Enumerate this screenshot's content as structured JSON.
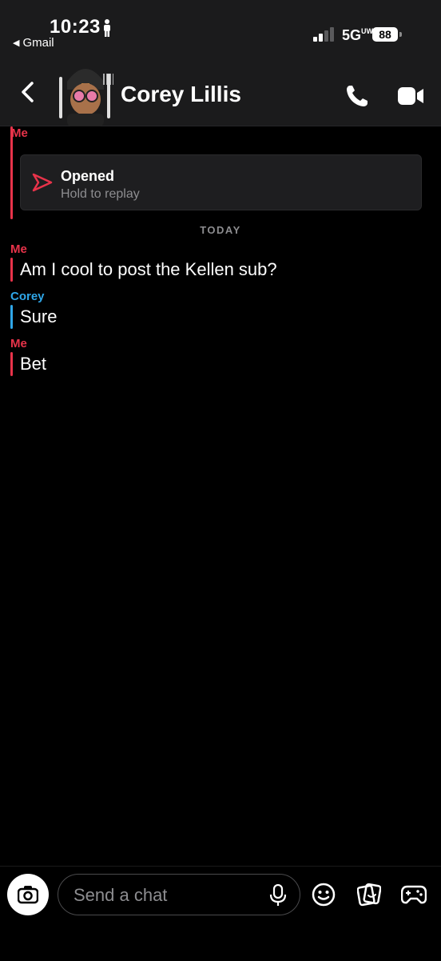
{
  "status_bar": {
    "time": "10:23",
    "back_app": "Gmail",
    "network": "5G",
    "network_sup": "UW",
    "battery": "88"
  },
  "header": {
    "contact_name": "Corey Lillis"
  },
  "chat": {
    "snap": {
      "sender": "Me",
      "status": "Opened",
      "hint": "Hold to replay"
    },
    "day_separator": "TODAY",
    "messages": [
      {
        "sender": "Me",
        "text": "Am I cool to post the Kellen sub?"
      },
      {
        "sender": "Corey",
        "text": "Sure"
      },
      {
        "sender": "Me",
        "text": "Bet"
      }
    ]
  },
  "composer": {
    "placeholder": "Send a chat"
  },
  "colors": {
    "me": "#e8334a",
    "them": "#2fa6e8",
    "background": "#000000",
    "header": "#1b1b1c"
  },
  "icons": [
    "person-icon",
    "signal-icon",
    "back-chevron-icon",
    "phone-icon",
    "video-icon",
    "send-arrow-icon",
    "camera-icon",
    "microphone-icon",
    "emoji-icon",
    "sticker-icon",
    "game-controller-icon"
  ]
}
